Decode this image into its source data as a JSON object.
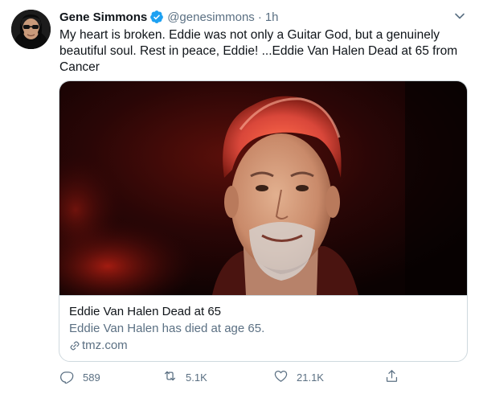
{
  "tweet": {
    "display_name": "Gene Simmons",
    "handle": "@genesimmons",
    "separator": "·",
    "time": "1h",
    "text": "My heart is broken. Eddie was not only a Guitar God, but a genuinely beautiful soul. Rest in peace, Eddie! ...Eddie Van Halen Dead at 65 from Cancer"
  },
  "card": {
    "title": "Eddie Van Halen Dead at 65",
    "description": "Eddie Van Halen has died at age 65.",
    "domain": "tmz.com"
  },
  "actions": {
    "replies": "589",
    "retweets": "5.1K",
    "likes": "21.1K"
  },
  "colors": {
    "verified_blue": "#1da1f2",
    "muted_text": "#5b7083",
    "border": "#cfd9de"
  },
  "icons": [
    "verified-badge-icon",
    "chevron-down-icon",
    "link-icon",
    "reply-icon",
    "retweet-icon",
    "like-icon",
    "share-icon"
  ]
}
